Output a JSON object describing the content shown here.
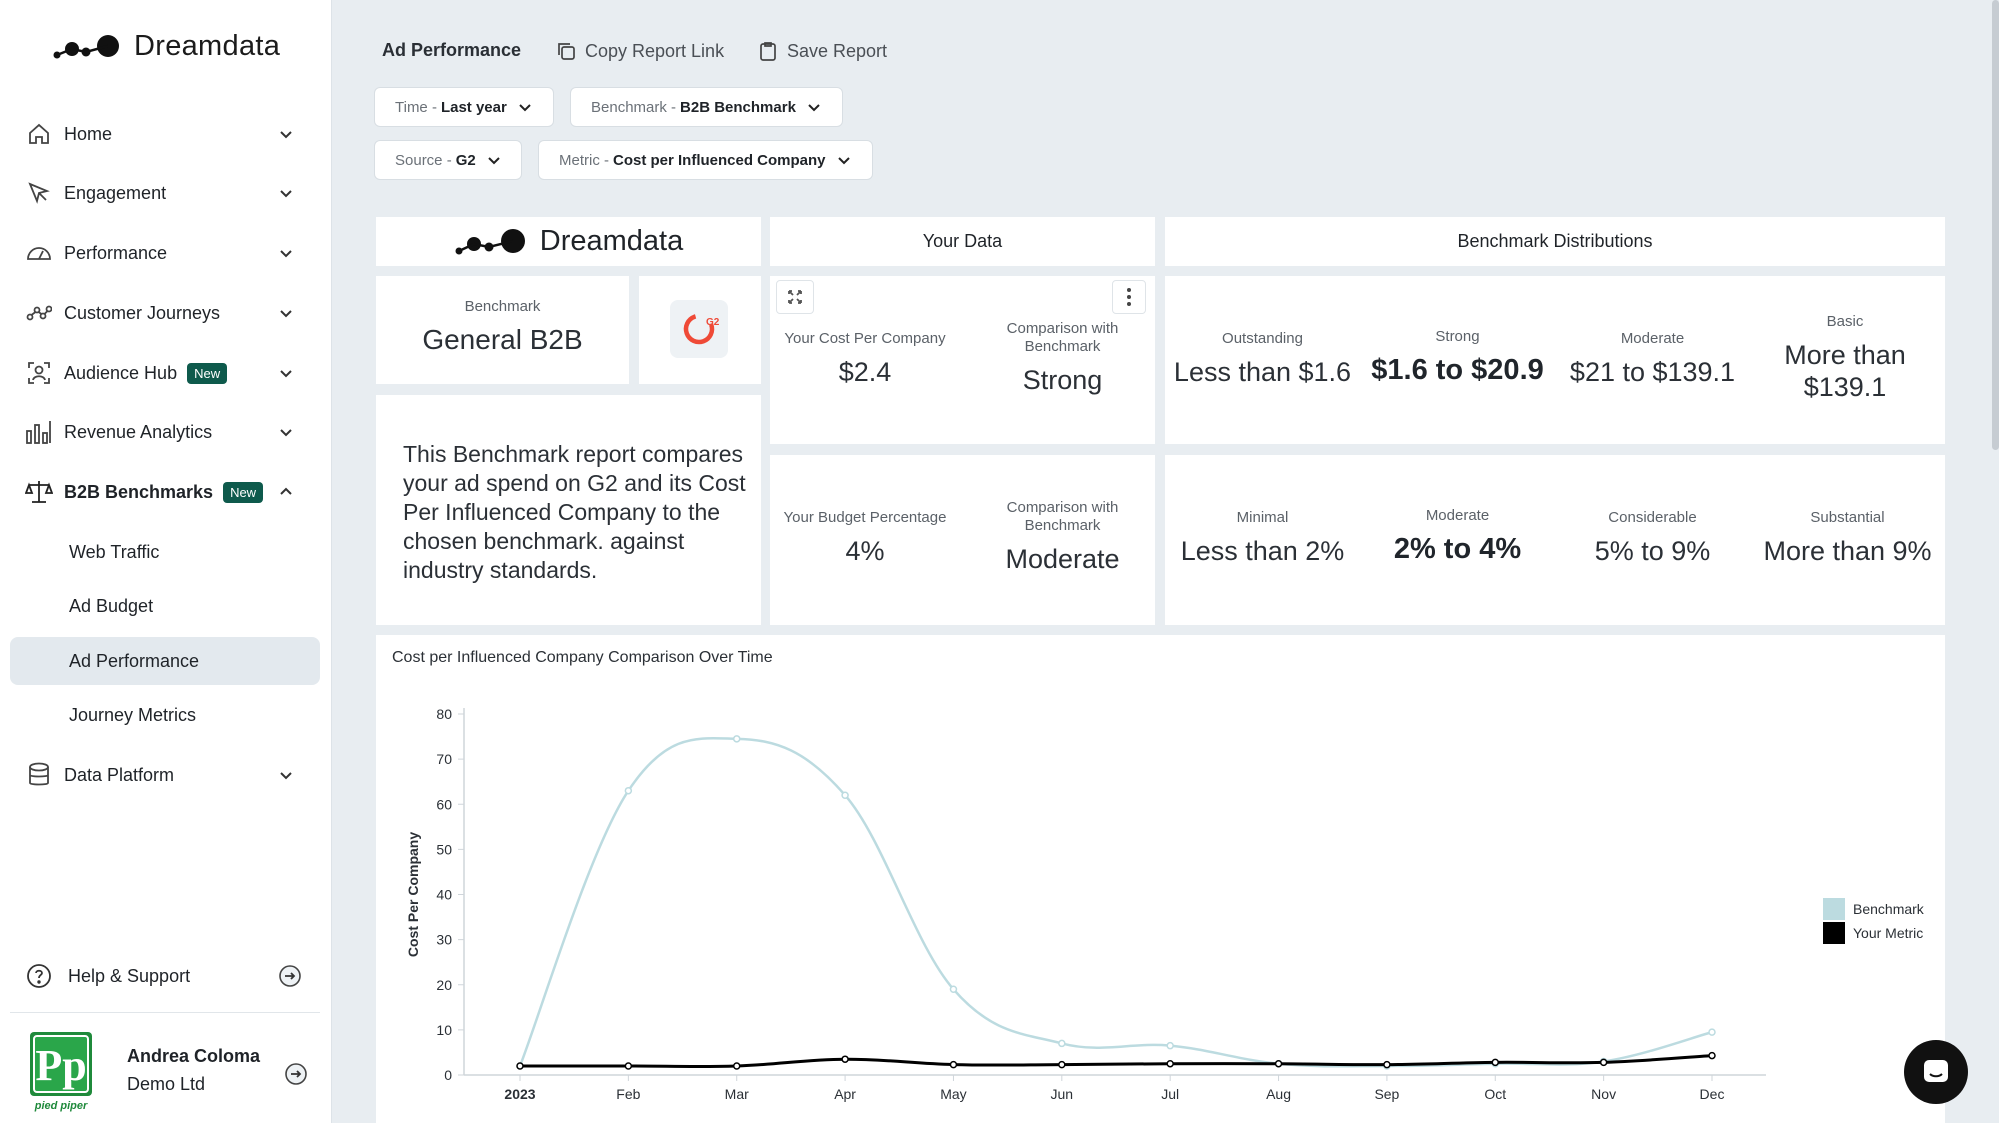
{
  "brand": {
    "name": "Dreamdata"
  },
  "sidebar": {
    "items": [
      {
        "label": "Home",
        "icon": "home-icon"
      },
      {
        "label": "Engagement",
        "icon": "cursor-icon"
      },
      {
        "label": "Performance",
        "icon": "gauge-icon"
      },
      {
        "label": "Customer Journeys",
        "icon": "journey-icon"
      },
      {
        "label": "Audience Hub",
        "icon": "audience-icon",
        "badge": "New"
      },
      {
        "label": "Revenue Analytics",
        "icon": "bar-chart-icon"
      },
      {
        "label": "B2B Benchmarks",
        "icon": "scale-icon",
        "badge": "New"
      },
      {
        "label": "Data Platform",
        "icon": "database-icon"
      }
    ],
    "sub_items": [
      "Web Traffic",
      "Ad Budget",
      "Ad Performance",
      "Journey Metrics"
    ],
    "help_label": "Help & Support",
    "user": {
      "name": "Andrea Coloma",
      "org": "Demo Ltd",
      "avatar_text": "pied piper"
    }
  },
  "header": {
    "title": "Ad Performance",
    "copy_link": "Copy Report Link",
    "save_report": "Save Report"
  },
  "filters": [
    {
      "prefix": "Time -",
      "value": "Last year"
    },
    {
      "prefix": "Benchmark -",
      "value": "B2B Benchmark"
    },
    {
      "prefix": "Source -",
      "value": "G2"
    },
    {
      "prefix": "Metric -",
      "value": "Cost per Influenced Company"
    }
  ],
  "report": {
    "your_data_header": "Your Data",
    "benchmark_dist_header": "Benchmark Distributions",
    "benchmark_label": "Benchmark",
    "benchmark_value": "General B2B",
    "source_logo": "G2",
    "description": "This Benchmark report compares your ad spend on G2 and its Cost Per Influenced Company to the chosen benchmark. against industry standards.",
    "your_cost": {
      "label": "Your Cost Per Company",
      "value": "$2.4"
    },
    "cost_comparison": {
      "label": "Comparison with Benchmark",
      "value": "Strong"
    },
    "your_budget": {
      "label": "Your Budget Percentage",
      "value": "4%"
    },
    "budget_comparison": {
      "label": "Comparison with Benchmark",
      "value": "Moderate"
    },
    "cost_distribution": [
      {
        "label": "Outstanding",
        "value": "Less than $1.6"
      },
      {
        "label": "Strong",
        "value": "$1.6 to $20.9"
      },
      {
        "label": "Moderate",
        "value": "$21 to $139.1"
      },
      {
        "label": "Basic",
        "value": "More than $139.1"
      }
    ],
    "budget_distribution": [
      {
        "label": "Minimal",
        "value": "Less than 2%"
      },
      {
        "label": "Moderate",
        "value": "2% to 4%"
      },
      {
        "label": "Considerable",
        "value": "5% to 9%"
      },
      {
        "label": "Substantial",
        "value": "More than 9%"
      }
    ]
  },
  "chart_data": {
    "type": "line",
    "title": "Cost per Influenced Company Comparison Over Time",
    "xlabel": "",
    "ylabel": "Cost Per Company",
    "categories": [
      "2023",
      "Feb",
      "Mar",
      "Apr",
      "May",
      "Jun",
      "Jul",
      "Aug",
      "Sep",
      "Oct",
      "Nov",
      "Dec"
    ],
    "ylim": [
      0,
      80
    ],
    "yticks": [
      0,
      10,
      20,
      30,
      40,
      50,
      60,
      70,
      80
    ],
    "legend": "right",
    "grid": false,
    "series": [
      {
        "name": "Benchmark",
        "color": "#bcdbe0",
        "values": [
          2,
          63,
          74.5,
          62,
          19,
          7,
          6.5,
          2.5,
          2,
          2.5,
          3,
          9.5
        ]
      },
      {
        "name": "Your Metric",
        "color": "#000000",
        "values": [
          2,
          2,
          2,
          3.5,
          2.3,
          2.3,
          2.5,
          2.5,
          2.3,
          2.8,
          2.8,
          4.3
        ]
      }
    ]
  }
}
